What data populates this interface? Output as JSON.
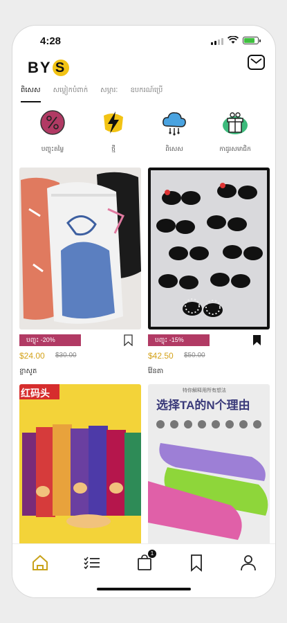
{
  "status_bar": {
    "time": "4:28"
  },
  "app": {
    "logo_text": "BY",
    "logo_badge": "S",
    "brand_color": "#f2c314"
  },
  "tabs": [
    {
      "label": "ពិសេស"
    },
    {
      "label": "សម្លៀកបំពាក់"
    },
    {
      "label": "សម្ភារៈ"
    },
    {
      "label": "ឧបករណ៍ប្រើ"
    }
  ],
  "categories": [
    {
      "label": "បញ្ចុះតម្លៃ",
      "icon": "discount-icon"
    },
    {
      "label": "ថ្មី",
      "icon": "lightning-icon"
    },
    {
      "label": "ពិសេស",
      "icon": "cloud-icon"
    },
    {
      "label": "កាដូរសមាជិក",
      "icon": "gift-icon"
    }
  ],
  "products": [
    {
      "discount": "បញ្ចុះ -20%",
      "price": "$24.00",
      "old_price": "$30.00",
      "name": "ខ្លាសូត",
      "bookmarked": false
    },
    {
      "discount": "បញ្ចុះ -15%",
      "price": "$42.50",
      "old_price": "$50.00",
      "name": "វ៉ែនតា",
      "bookmarked": true
    },
    {
      "image_text_1": "红码头",
      "bookmarked": false
    },
    {
      "image_text_1": "特你解释用所有想法",
      "image_text_2": "选择TA的N个理由",
      "bookmarked": true
    }
  ],
  "bottom_nav": {
    "cart_count": "1",
    "active": "home"
  },
  "colors": {
    "accent": "#b13a64",
    "price": "#d4a21a",
    "home_active": "#c8a21a"
  }
}
